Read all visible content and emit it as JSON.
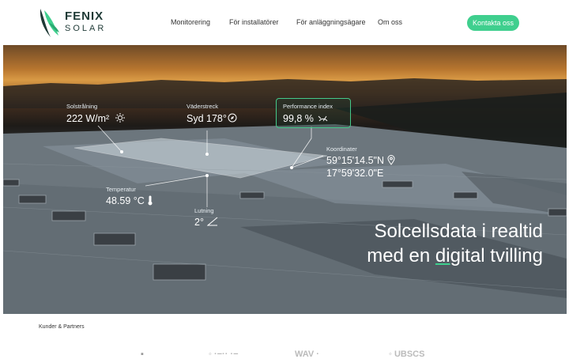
{
  "header": {
    "logo_line1": "FENIX",
    "logo_line2": "SOLAR",
    "nav": [
      "Monitorering",
      "För installatörer",
      "För anläggningsägare",
      "Om oss"
    ],
    "cta_label": "Kontakta oss"
  },
  "hero": {
    "irradiance": {
      "label": "Solstrålning",
      "value": "222 W/m²",
      "icon": "sun-icon"
    },
    "direction": {
      "label": "Väderstreck",
      "value": "Syd 178°",
      "icon": "compass-icon"
    },
    "performance": {
      "label": "Performance index",
      "value": "99,8 %",
      "icon": "gauge-icon"
    },
    "coordinates": {
      "label": "Koordinater",
      "lat": "59°15'14.5\"N",
      "lon": "17°59'32.0\"E",
      "icon": "location-pin-icon"
    },
    "temperature": {
      "label": "Temperatur",
      "value": "48.59 °C",
      "icon": "thermometer-icon"
    },
    "tilt": {
      "label": "Lutning",
      "value": "2°",
      "icon": "angle-icon"
    },
    "headline_line1": "Solcellsdata i realtid",
    "headline_line2_pre": "med en ",
    "headline_line2_u": "di",
    "headline_line2_post": "gital tvilling"
  },
  "partners": {
    "title": "Kunder & Partners",
    "logos": [
      "▪",
      "◦ ·−·· ·−",
      "WAV ·",
      "◦ UBSCS"
    ]
  },
  "colors": {
    "accent": "#3fcf8e",
    "brand_dark": "#1f3a36"
  }
}
